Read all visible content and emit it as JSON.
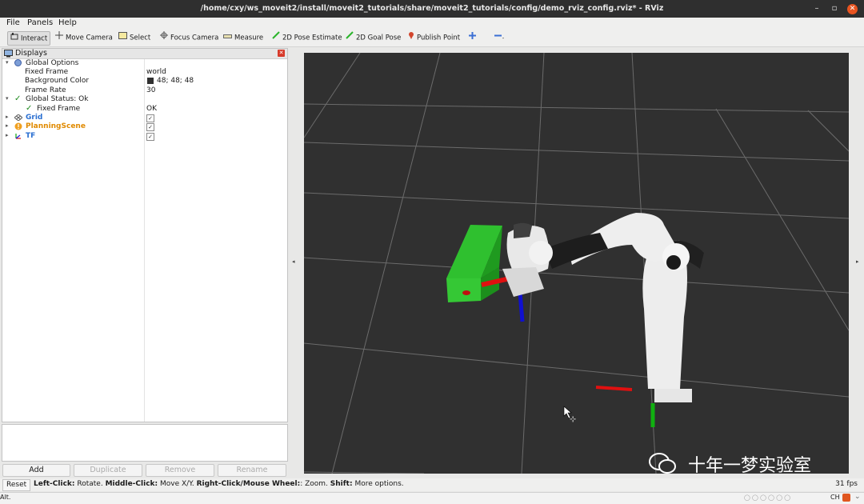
{
  "window": {
    "title": "/home/cxy/ws_moveit2/install/moveit2_tutorials/share/moveit2_tutorials/config/demo_rviz_config.rviz* - RViz"
  },
  "menu": {
    "file": "File",
    "panels": "Panels",
    "help": "Help"
  },
  "toolbar": {
    "interact": "Interact",
    "move_camera": "Move Camera",
    "select": "Select",
    "focus_camera": "Focus Camera",
    "measure": "Measure",
    "pose_estimate": "2D Pose Estimate",
    "goal_pose": "2D Goal Pose",
    "publish_point": "Publish Point"
  },
  "displays": {
    "header": "Displays",
    "global_options": {
      "label": "Global Options",
      "fixed_frame": {
        "key": "Fixed Frame",
        "value": "world"
      },
      "background_color": {
        "key": "Background Color",
        "value": "48; 48; 48",
        "swatch": "#303030"
      },
      "frame_rate": {
        "key": "Frame Rate",
        "value": "30"
      }
    },
    "global_status": {
      "label": "Global Status: Ok",
      "fixed_frame": {
        "key": "Fixed Frame",
        "value": "OK"
      }
    },
    "items": [
      {
        "label": "Grid",
        "color": "#2a6fd1",
        "checked": true
      },
      {
        "label": "PlanningScene",
        "color": "#e08a00",
        "checked": true
      },
      {
        "label": "TF",
        "color": "#2a6fd1",
        "checked": true
      }
    ],
    "buttons": {
      "add": "Add",
      "duplicate": "Duplicate",
      "remove": "Remove",
      "rename": "Rename"
    }
  },
  "status": {
    "reset": "Reset",
    "hint_left_click": "Left-Click:",
    "hint_rotate": " Rotate. ",
    "hint_middle_click": "Middle-Click:",
    "hint_move": " Move X/Y. ",
    "hint_right_click": "Right-Click/Mouse Wheel:",
    "hint_zoom": ": Zoom. ",
    "hint_shift": "Shift:",
    "hint_more": " More options.",
    "fps": "31 fps"
  },
  "taskbar": {
    "left": "Alt.",
    "lang": "CH"
  },
  "watermark": "十年一梦实验室",
  "colors": {
    "accent_blue": "#2a6fd1",
    "accent_orange": "#e08a00",
    "background": "#303030",
    "box_green": "#2fc02f",
    "axis_red": "#e01010",
    "axis_green": "#10b010",
    "axis_blue": "#1010d0"
  }
}
